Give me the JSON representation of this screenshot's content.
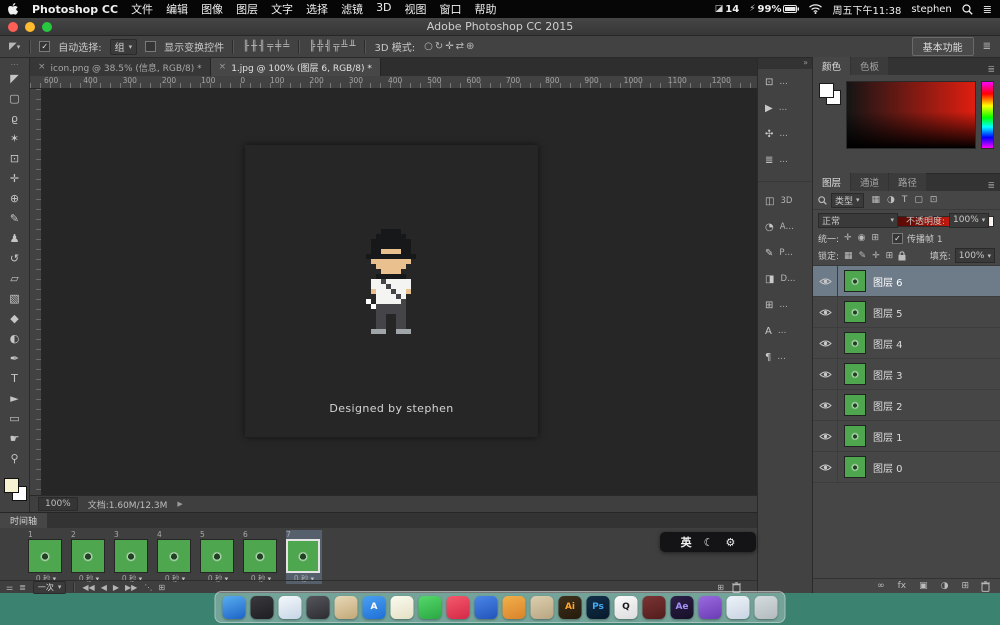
{
  "desktop": {
    "wallpaper": "#3c8270"
  },
  "menubar": {
    "app_name": "Photoshop CC",
    "menus": [
      "文件",
      "编辑",
      "图像",
      "图层",
      "文字",
      "选择",
      "滤镜",
      "3D",
      "视图",
      "窗口",
      "帮助"
    ],
    "status_metric": "14",
    "battery": "99%",
    "clock": "周五下午11:38",
    "user": "stephen"
  },
  "titlebar": {
    "title": "Adobe Photoshop CC 2015"
  },
  "options": {
    "auto_select_check": "✓",
    "auto_select_label": "自动选择:",
    "auto_select_value": "组",
    "show_transform_label": "显示变换控件",
    "mode_label": "3D 模式:",
    "workspace": "基本功能",
    "align_icons": [
      "╟",
      "╫",
      "╢",
      "╤",
      "╪",
      "╧"
    ],
    "distribute_icons": [
      "╠",
      "╬",
      "╣",
      "╦",
      "╩",
      "╨"
    ],
    "mode_icons": [
      "○",
      "↻",
      "✛",
      "⇄",
      "⊕"
    ]
  },
  "tabs": [
    {
      "label": "icon.png @ 38.5% (信息, RGB/8) *",
      "active": false
    },
    {
      "label": "1.jpg @ 100% (图层 6, RGB/8) *",
      "active": true
    }
  ],
  "ruler": {
    "labels": [
      "600",
      "400",
      "300",
      "200",
      "100",
      "0",
      "100",
      "200",
      "300",
      "400",
      "500",
      "600",
      "700",
      "800",
      "900",
      "1000",
      "1100",
      "1200"
    ]
  },
  "tools": [
    {
      "name": "move-tool",
      "glyph": "◤"
    },
    {
      "name": "rectangular-marquee-tool",
      "glyph": "▢"
    },
    {
      "name": "lasso-tool",
      "glyph": "ϱ"
    },
    {
      "name": "magic-wand-tool",
      "glyph": "✶"
    },
    {
      "name": "crop-tool",
      "glyph": "⊡"
    },
    {
      "name": "eyedropper-tool",
      "glyph": "✛"
    },
    {
      "name": "spot-healing-brush-tool",
      "glyph": "⊕"
    },
    {
      "name": "brush-tool",
      "glyph": "✎"
    },
    {
      "name": "clone-stamp-tool",
      "glyph": "♟"
    },
    {
      "name": "history-brush-tool",
      "glyph": "↺"
    },
    {
      "name": "eraser-tool",
      "glyph": "▱"
    },
    {
      "name": "gradient-tool",
      "glyph": "▧"
    },
    {
      "name": "blur-tool",
      "glyph": "◆"
    },
    {
      "name": "dodge-tool",
      "glyph": "◐"
    },
    {
      "name": "pen-tool",
      "glyph": "✒"
    },
    {
      "name": "type-tool",
      "glyph": "T"
    },
    {
      "name": "path-selection-tool",
      "glyph": "►"
    },
    {
      "name": "shape-tool",
      "glyph": "▭"
    },
    {
      "name": "hand-tool",
      "glyph": "☛"
    },
    {
      "name": "zoom-tool",
      "glyph": "⚲"
    }
  ],
  "canvas": {
    "caption": "Designed by stephen",
    "bg": "#4ea64f",
    "sprite": {
      "scale": 5,
      "palette": {
        "B": "#17181a",
        "S": "#eac08f",
        "W": "#f4f4f2",
        "D": "#454549",
        "G": "#9fa5a8",
        "X": "#ffffff"
      },
      "rows": [
        "...BBBB...",
        "..BBBBBB..",
        ".BBBBBBBB.",
        ".BBBBBBBB.",
        ".BBSSSSBB.",
        "BBBBBBBBBB",
        ".SSSSSSSS.",
        "..SSSSSS..",
        "...SSSS...",
        "..BBBBBB..",
        ".WWDWWWWW.",
        ".WWWDWWWW.",
        ".SWWWDWWS.",
        "..WWWWDW..",
        "X.WWWWWD..",
        ".XDDDDDD..",
        "..DDDDDD..",
        "..DD..DD..",
        "..DD..DD..",
        "..DD..DD..",
        ".GGG..GGG."
      ]
    }
  },
  "statusbar": {
    "zoom": "100%",
    "doc": "文档:1.60M/12.3M",
    "arrow": "▶"
  },
  "timeline": {
    "tab": "时间轴",
    "loop": "一次",
    "selected": 7,
    "frames": [
      {
        "n": "1",
        "delay": "0 秒"
      },
      {
        "n": "2",
        "delay": "0 秒"
      },
      {
        "n": "3",
        "delay": "0 秒"
      },
      {
        "n": "4",
        "delay": "0 秒"
      },
      {
        "n": "5",
        "delay": "0 秒"
      },
      {
        "n": "6",
        "delay": "0 秒"
      },
      {
        "n": "7",
        "delay": "0 秒"
      }
    ],
    "convert_icons": [
      "⚌",
      "≣"
    ],
    "playback_icons": [
      "◀◀",
      "◀",
      "▶",
      "▶▶"
    ],
    "edit_icons": [
      "⋱",
      "⊞"
    ],
    "right_icons": [
      "⊞"
    ]
  },
  "input_switcher": {
    "lang": "英",
    "moon": "☾",
    "gear": "⚙"
  },
  "panel_strip": [
    {
      "name": "collapsed-panel-info",
      "glyph": "⊡",
      "label": "…"
    },
    {
      "name": "collapsed-panel-actions",
      "glyph": "▶",
      "label": "…"
    },
    {
      "name": "collapsed-panel-history",
      "glyph": "✣",
      "label": "…"
    },
    {
      "name": "collapsed-panel-styles",
      "glyph": "≣",
      "label": "…"
    },
    {
      "name": "collapsed-panel-3d",
      "glyph": "◫",
      "label": "3D"
    },
    {
      "name": "collapsed-panel-adjustments",
      "glyph": "◔",
      "label": "A…"
    },
    {
      "name": "collapsed-panel-properties",
      "glyph": "✎",
      "label": "P…"
    },
    {
      "name": "collapsed-panel-d",
      "glyph": "◨",
      "label": "D…"
    },
    {
      "name": "collapsed-panel-misc",
      "glyph": "⊞",
      "label": "…"
    },
    {
      "name": "collapsed-panel-character",
      "glyph": "A",
      "label": "…"
    },
    {
      "name": "collapsed-panel-paragraph",
      "glyph": "¶",
      "label": "…"
    }
  ],
  "color_panel": {
    "tabs": [
      "颜色",
      "色板"
    ],
    "menu_icon": "≣"
  },
  "layers_panel": {
    "tabs": [
      "图层",
      "通道",
      "路径"
    ],
    "kind": "类型",
    "filter_icons": [
      "▦",
      "◑",
      "T",
      "▢",
      "⊡"
    ],
    "blend": "正常",
    "opacity_label": "不透明度:",
    "opacity": "100%",
    "unify_label": "统一:",
    "unify_icons": [
      "✛",
      "◉",
      "⊞"
    ],
    "propagate_check": "✓",
    "propagate": "传播帧 1",
    "lock_label": "锁定:",
    "lock_icons": [
      "▦",
      "✎",
      "✛",
      "⊞"
    ],
    "fill_label": "填充:",
    "fill": "100%",
    "layers": [
      {
        "name": "图层 6",
        "selected": true
      },
      {
        "name": "图层 5",
        "selected": false
      },
      {
        "name": "图层 4",
        "selected": false
      },
      {
        "name": "图层 3",
        "selected": false
      },
      {
        "name": "图层 2",
        "selected": false
      },
      {
        "name": "图层 1",
        "selected": false
      },
      {
        "name": "图层 0",
        "selected": false
      }
    ],
    "bottom_icons": [
      "∞",
      "fx",
      "▣",
      "◑",
      "⊞"
    ]
  },
  "dock": {
    "items": [
      {
        "name": "dock-finder",
        "c1": "#58aef0",
        "c2": "#1d63c6",
        "label": ""
      },
      {
        "name": "dock-app-dark-circle",
        "c1": "#3a3a3e",
        "c2": "#1e1e22",
        "label": ""
      },
      {
        "name": "dock-browser",
        "c1": "#f4f8fc",
        "c2": "#c6d5e6",
        "label": ""
      },
      {
        "name": "dock-camera",
        "c1": "#55555c",
        "c2": "#2c2c32",
        "label": ""
      },
      {
        "name": "dock-basket",
        "c1": "#e8d8b8",
        "c2": "#c2a878",
        "label": ""
      },
      {
        "name": "dock-appstore",
        "c1": "#4aa0f2",
        "c2": "#1f6fd6",
        "label": "A"
      },
      {
        "name": "dock-notes",
        "c1": "#fbfbef",
        "c2": "#e4e0c4",
        "label": ""
      },
      {
        "name": "dock-wechat",
        "c1": "#55d86a",
        "c2": "#2aa843",
        "label": ""
      },
      {
        "name": "dock-music",
        "c1": "#f55a6c",
        "c2": "#d42848",
        "label": ""
      },
      {
        "name": "dock-blue-app",
        "c1": "#4a86e8",
        "c2": "#2254b8",
        "label": ""
      },
      {
        "name": "dock-orange-app",
        "c1": "#f2b04a",
        "c2": "#d8832a",
        "label": ""
      },
      {
        "name": "dock-stamp",
        "c1": "#dccfae",
        "c2": "#b8a582",
        "label": ""
      },
      {
        "name": "dock-illustrator",
        "c1": "#40301a",
        "c2": "#241a0c",
        "label": "Ai",
        "fg": "#ffa52e"
      },
      {
        "name": "dock-photoshop",
        "c1": "#12304a",
        "c2": "#081a2c",
        "label": "Ps",
        "fg": "#42aaf5"
      },
      {
        "name": "dock-qq",
        "c1": "#fbfbfb",
        "c2": "#dcdcdc",
        "label": "Q",
        "fg": "#16181c"
      },
      {
        "name": "dock-red-dark-app",
        "c1": "#7c3434",
        "c2": "#521c1c",
        "label": ""
      },
      {
        "name": "dock-aftereffects",
        "c1": "#2c2048",
        "c2": "#160f28",
        "label": "Ae",
        "fg": "#a292f5"
      },
      {
        "name": "dock-purple-app",
        "c1": "#9a6ae0",
        "c2": "#6a3cb4",
        "label": ""
      },
      {
        "name": "dock-mail",
        "c1": "#eef3f9",
        "c2": "#c8d4e2",
        "label": ""
      },
      {
        "name": "dock-trash",
        "c1": "rgba(230,230,236,.85)",
        "c2": "rgba(190,190,198,.85)",
        "label": ""
      }
    ]
  }
}
